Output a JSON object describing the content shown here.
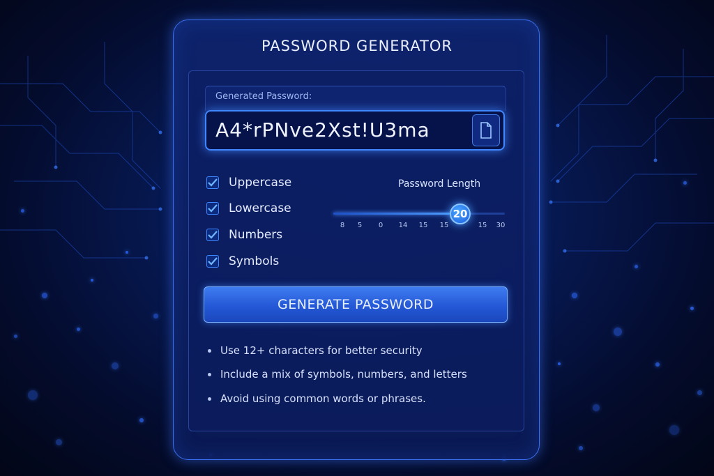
{
  "title": "PASSWORD GENERATOR",
  "password": {
    "label": "Generated Password:",
    "value": "A4*rPNve2Xst!U3ma",
    "copy_icon": "copy-icon"
  },
  "options": [
    {
      "label": "Uppercase",
      "checked": true
    },
    {
      "label": "Lowercase",
      "checked": true
    },
    {
      "label": "Numbers",
      "checked": true
    },
    {
      "label": "Symbols",
      "checked": true
    }
  ],
  "length": {
    "label": "Password Length",
    "value": "20",
    "fraction": 0.74,
    "ticks": [
      "8",
      "5",
      "0",
      "14",
      "15",
      "15",
      "15",
      "30"
    ]
  },
  "generate_button": "GENERATE PASSWORD",
  "tips": [
    "Use 12+ characters for better security",
    "Include a mix of symbols, numbers, and letters",
    "Avoid using common words or phrases."
  ],
  "colors": {
    "accent": "#3f86ff",
    "background": "#071a55",
    "button": "#2458d6"
  }
}
